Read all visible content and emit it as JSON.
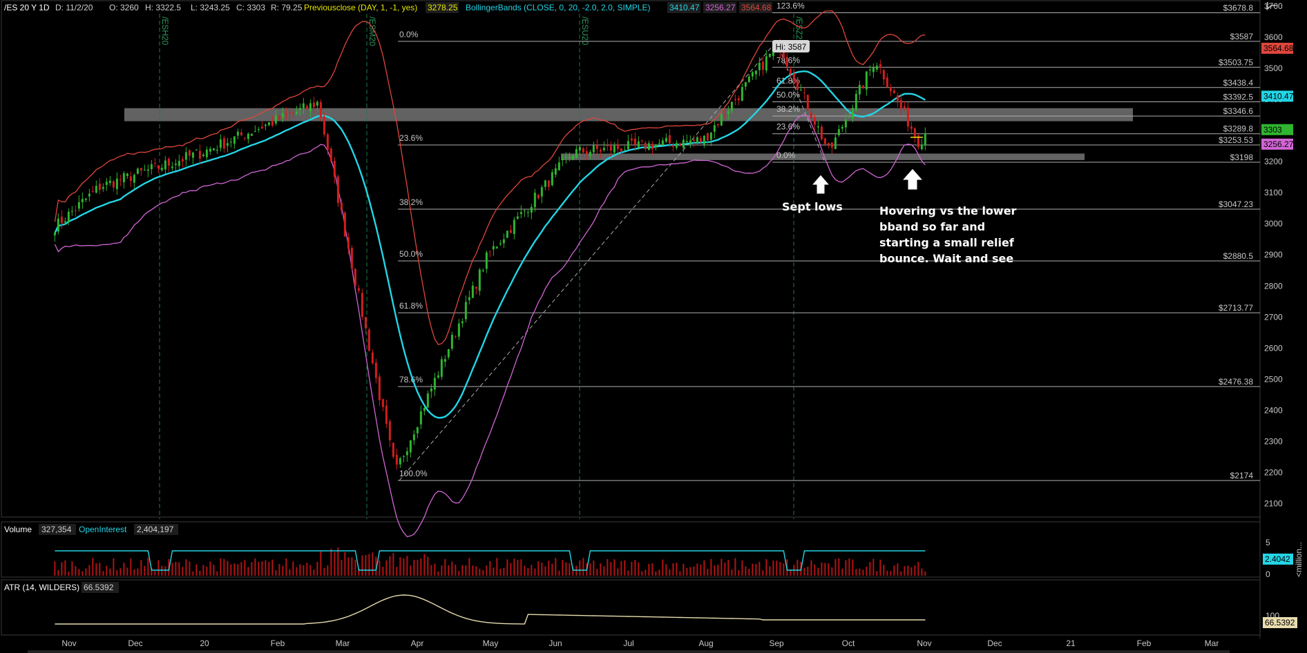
{
  "header": {
    "symbol": "/ES 20 Y 1D",
    "date": "D: 11/2/20",
    "open": "O: 3260",
    "high": "H: 3322.5",
    "low": "L: 3243.25",
    "close": "C: 3303",
    "range": "R: 79.25",
    "prev_label": "Previousclose (DAY, 1, -1, yes)",
    "prev_value": "3278.25",
    "bb_label": "BollingerBands (CLOSE, 0, 20, -2.0, 2.0, SIMPLE)",
    "bb_mid": "3410.47",
    "bb_low": "3256.27",
    "bb_up": "3564.68"
  },
  "colors": {
    "up": "#2fb52f",
    "down": "#d21e1e",
    "mid_band": "#23d5e6",
    "lower_band": "#d266d6",
    "upper_band": "#e0463c",
    "prev": "#e6e600",
    "volume_bar": "#b31414",
    "open_interest": "#23d5e6",
    "atr": "#e8dcb0"
  },
  "chart_data": {
    "type": "candlestick",
    "y_axis": {
      "min": 2050,
      "max": 3720,
      "ticks": [
        "3700",
        "3600",
        "3500",
        "3400",
        "3300",
        "3200",
        "3100",
        "3000",
        "2900",
        "2800",
        "2700",
        "2600",
        "2500",
        "2400",
        "2300",
        "2200",
        "2100"
      ]
    },
    "x_ticks": [
      "Nov",
      "Dec",
      "20",
      "Feb",
      "Mar",
      "Apr",
      "May",
      "Jun",
      "Jul",
      "Aug",
      "Sep",
      "Oct",
      "Nov",
      "Dec",
      "21",
      "Feb",
      "Mar"
    ],
    "contract_rolls": [
      "/ESH20",
      "/ESM20",
      "/ESU20",
      "/ESZ20"
    ],
    "key_points": [
      {
        "date": "2019-10-22",
        "close": 2990
      },
      {
        "date": "2019-11-15",
        "close": 3120
      },
      {
        "date": "2019-12-31",
        "close": 3230
      },
      {
        "date": "2020-02-19",
        "close": 3390
      },
      {
        "date": "2020-03-23",
        "close": 2200
      },
      {
        "date": "2020-04-30",
        "close": 2900
      },
      {
        "date": "2020-06-08",
        "close": 3230
      },
      {
        "date": "2020-07-31",
        "close": 3270
      },
      {
        "date": "2020-09-02",
        "close": 3580
      },
      {
        "date": "2020-09-23",
        "close": 3230
      },
      {
        "date": "2020-10-12",
        "close": 3530
      },
      {
        "date": "2020-10-30",
        "close": 3260
      },
      {
        "date": "2020-11-02",
        "close": 3303
      }
    ],
    "price_levels": [
      {
        "label": "$3678.8",
        "value": 3678.8
      },
      {
        "label": "$3587",
        "value": 3587
      },
      {
        "label": "$3503.75",
        "value": 3503.75
      },
      {
        "label": "$3438.4",
        "value": 3438.4
      },
      {
        "label": "$3392.5",
        "value": 3392.5
      },
      {
        "label": "$3346.6",
        "value": 3346.6
      },
      {
        "label": "$3289.8",
        "value": 3289.8
      },
      {
        "label": "$3253.53",
        "value": 3253.53
      },
      {
        "label": "$3198",
        "value": 3198
      },
      {
        "label": "$3047.23",
        "value": 3047.23
      },
      {
        "label": "$2880.5",
        "value": 2880.5
      },
      {
        "label": "$2713.77",
        "value": 2713.77
      },
      {
        "label": "$2476.38",
        "value": 2476.38
      },
      {
        "label": "$2174",
        "value": 2174
      }
    ],
    "fib_large": [
      "0.0%",
      "23.6%",
      "38.2%",
      "50.0%",
      "61.8%",
      "78.6%",
      "100.0%"
    ],
    "fib_small": [
      "123.6%",
      "78.6%",
      "61.8%",
      "50.0%",
      "38.2%",
      "23.6%",
      "0.0%"
    ],
    "zones": [
      {
        "low": 3330,
        "high": 3372
      },
      {
        "low": 3205,
        "high": 3226
      }
    ],
    "hi_label": "Hi: 3587",
    "badges": {
      "upper": "3564.68",
      "mid": "3410.47",
      "last": "3303",
      "lower": "3256.27"
    }
  },
  "annotations": {
    "sept": "Sept lows",
    "note": [
      "Hovering vs the lower",
      "bband so far and",
      "starting a small relief",
      "bounce. Wait and see"
    ]
  },
  "volume": {
    "label": "Volume",
    "value": "327,354",
    "oi_label": "OpenInterest",
    "oi_value": "2,404,197",
    "scale_top": "5",
    "scale_bottom": "0",
    "oi_badge": "2.4042",
    "unit": "<million..."
  },
  "atr": {
    "label": "ATR (14, WILDERS)",
    "value": "66.5392",
    "scale": "100",
    "badge": "66.5392"
  }
}
